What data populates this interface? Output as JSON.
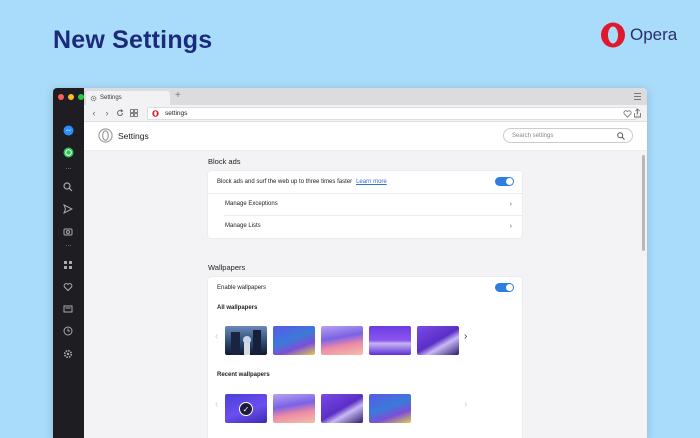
{
  "headline": "New Settings",
  "brand": {
    "name": "Opera",
    "color": "#e0182d"
  },
  "browser": {
    "tab": {
      "title": "Settings",
      "icon": "gear-icon"
    },
    "new_tab": "+",
    "address": {
      "url": "settings"
    }
  },
  "settings": {
    "title": "Settings",
    "search_placeholder": "Search settings",
    "block_ads": {
      "section_title": "Block ads",
      "description": "Block ads and surf the web up to three times faster",
      "learn_more": "Learn more",
      "enabled": true,
      "rows": [
        {
          "label": "Manage Exceptions"
        },
        {
          "label": "Manage Lists"
        }
      ]
    },
    "wallpapers": {
      "section_title": "Wallpapers",
      "enable_label": "Enable wallpapers",
      "enabled": true,
      "all_label": "All wallpapers",
      "recent_label": "Recent wallpapers"
    }
  },
  "accent_color": "#2d7ee0"
}
